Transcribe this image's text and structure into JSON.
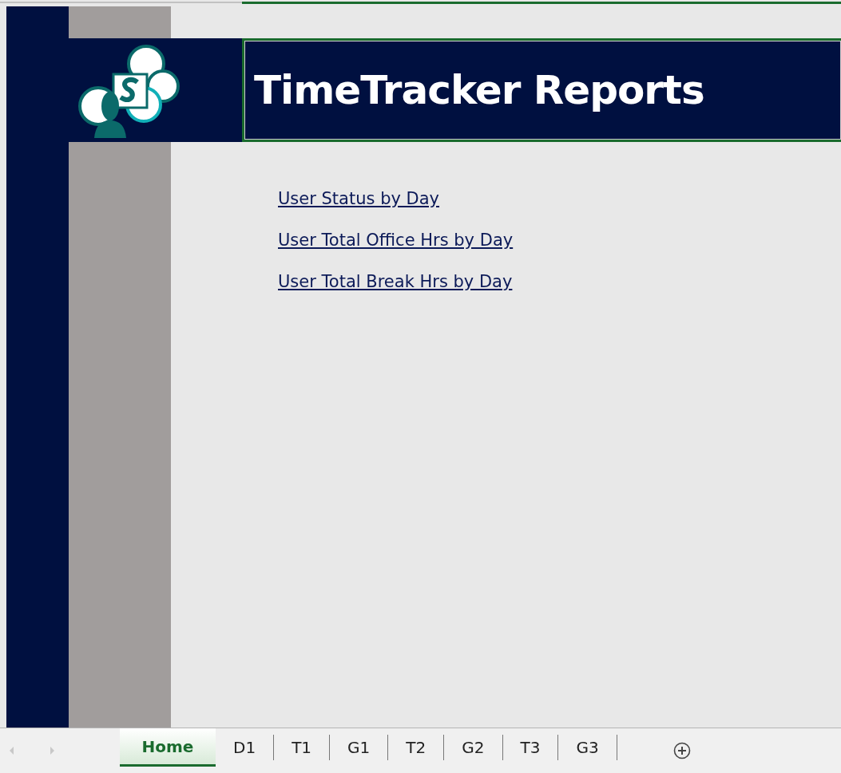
{
  "header": {
    "title": "TimeTracker Reports"
  },
  "links": [
    "User Status by Day",
    "User Total Office Hrs by Day",
    "User Total Break Hrs by Day"
  ],
  "sheet_tabs": [
    {
      "label": "Home",
      "selected": true
    },
    {
      "label": "D1",
      "selected": false
    },
    {
      "label": "T1",
      "selected": false
    },
    {
      "label": "G1",
      "selected": false
    },
    {
      "label": "T2",
      "selected": false
    },
    {
      "label": "G2",
      "selected": false
    },
    {
      "label": "T3",
      "selected": false
    },
    {
      "label": "G3",
      "selected": false
    }
  ]
}
